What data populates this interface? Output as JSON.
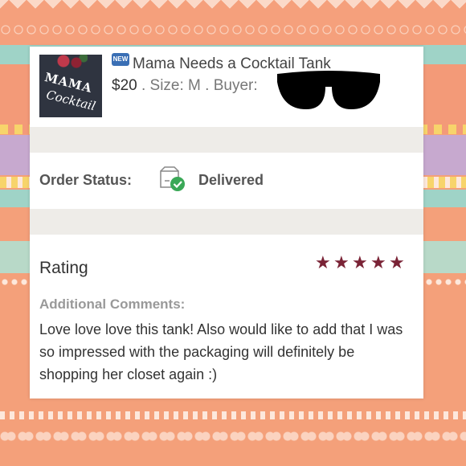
{
  "listing": {
    "badge": "NEW",
    "title": "Mama Needs a Cocktail Tank",
    "price": "$20",
    "size_text": " . Size: M . Buyer: ",
    "thumb_text_1": "MAMA",
    "thumb_text_2": "Cocktail"
  },
  "order": {
    "status_label": "Order Status:",
    "status_value": "Delivered",
    "status_icon": "box-delivered-icon"
  },
  "review": {
    "rating_label": "Rating",
    "stars": 5,
    "star_color": "#7a2336",
    "comments_label": "Additional Comments:",
    "comment": "Love love love this tank! Also would like to add that I was so impressed with the packaging will definitely be shopping her closet again :)"
  }
}
